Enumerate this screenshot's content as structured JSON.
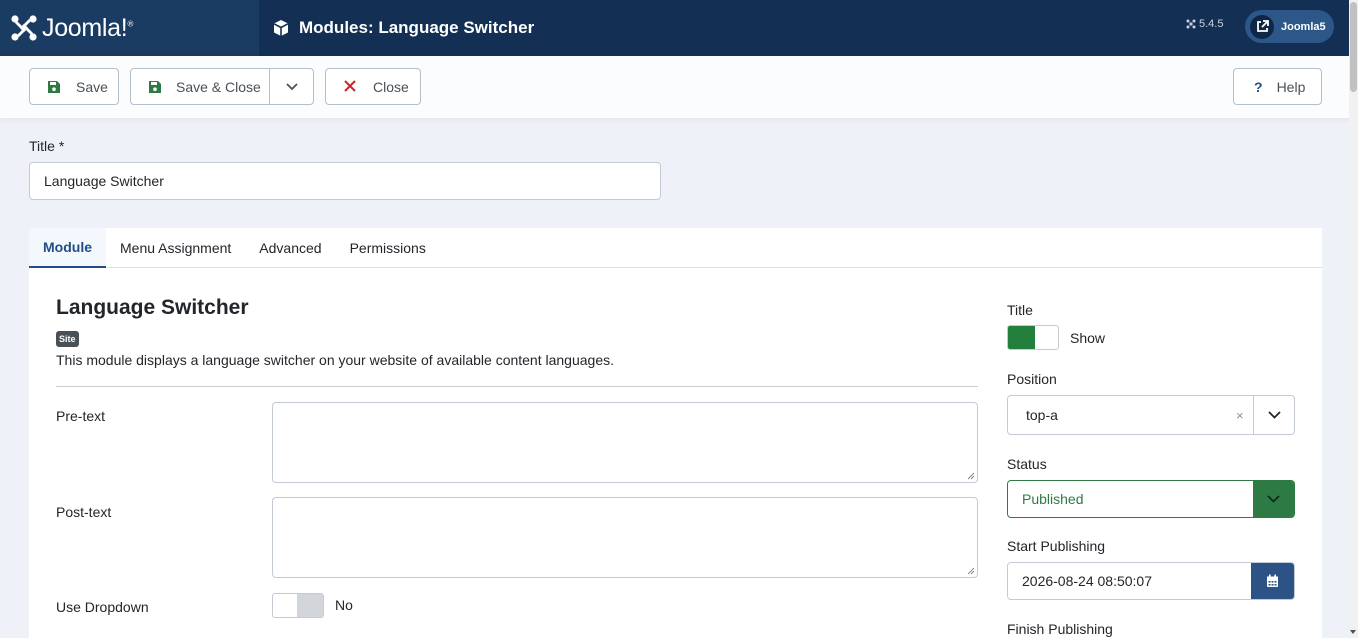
{
  "header": {
    "logo_text": "Joomla!",
    "logo_reg": "®",
    "page_title": "Modules: Language Switcher",
    "version": "5.4.5",
    "user_name": "Joomla5"
  },
  "toolbar": {
    "save_label": "Save",
    "save_close_label": "Save & Close",
    "close_label": "Close",
    "help_label": "Help",
    "help_symbol": "?"
  },
  "title_field": {
    "label": "Title *",
    "value": "Language Switcher"
  },
  "tabs": [
    {
      "label": "Module",
      "active": true
    },
    {
      "label": "Menu Assignment",
      "active": false
    },
    {
      "label": "Advanced",
      "active": false
    },
    {
      "label": "Permissions",
      "active": false
    }
  ],
  "module": {
    "heading": "Language Switcher",
    "badge": "Site",
    "description": "This module displays a language switcher on your website of available content languages."
  },
  "fields": {
    "pretext_label": "Pre-text",
    "pretext_value": "",
    "posttext_label": "Post-text",
    "posttext_value": "",
    "use_dropdown_label": "Use Dropdown",
    "use_dropdown_value": "No"
  },
  "sidebar": {
    "title_label": "Title",
    "title_toggle": "Show",
    "position_label": "Position",
    "position_value": "top-a",
    "position_clear": "×",
    "status_label": "Status",
    "status_value": "Published",
    "start_publishing_label": "Start Publishing",
    "start_publishing_value": "2026-08-24 08:50:07",
    "finish_publishing_label": "Finish Publishing"
  },
  "colors": {
    "header_bg": "#132f53",
    "accent": "#1f4f86",
    "success": "#2e7a45",
    "danger": "#c52827"
  }
}
